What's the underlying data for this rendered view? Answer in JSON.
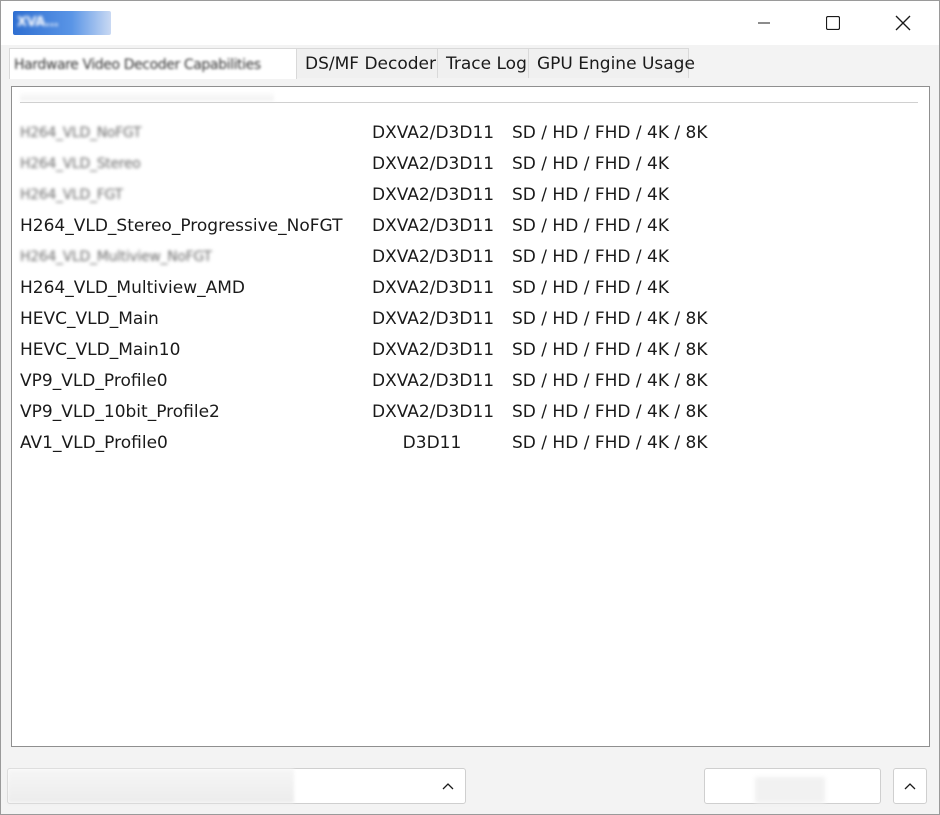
{
  "window": {
    "title": "XVA..."
  },
  "titlebar_buttons": {
    "minimize_icon": "minimize-icon",
    "maximize_icon": "maximize-icon",
    "close_icon": "close-icon"
  },
  "tabs": [
    {
      "label": "Hardware Video Decoder Capabilities",
      "active": true
    },
    {
      "label": "DS/MF Decoder",
      "active": false
    },
    {
      "label": "Trace Log",
      "active": false
    },
    {
      "label": "GPU Engine Usage",
      "active": false
    }
  ],
  "decoder_list": {
    "rows": [
      {
        "name": "H264_VLD_NoFGT",
        "api": "DXVA2/D3D11",
        "resolutions": "SD / HD / FHD / 4K / 8K",
        "name_blurred": true
      },
      {
        "name": "H264_VLD_Stereo",
        "api": "DXVA2/D3D11",
        "resolutions": "SD / HD / FHD / 4K",
        "name_blurred": true
      },
      {
        "name": "H264_VLD_FGT",
        "api": "DXVA2/D3D11",
        "resolutions": "SD / HD / FHD / 4K",
        "name_blurred": true
      },
      {
        "name": "H264_VLD_Stereo_Progressive_NoFGT",
        "api": "DXVA2/D3D11",
        "resolutions": "SD / HD / FHD / 4K",
        "name_blurred": false
      },
      {
        "name": "H264_VLD_Multiview_NoFGT",
        "api": "DXVA2/D3D11",
        "resolutions": "SD / HD / FHD / 4K",
        "name_blurred": true
      },
      {
        "name": "H264_VLD_Multiview_AMD",
        "api": "DXVA2/D3D11",
        "resolutions": "SD / HD / FHD / 4K",
        "name_blurred": false
      },
      {
        "name": "HEVC_VLD_Main",
        "api": "DXVA2/D3D11",
        "resolutions": "SD / HD / FHD / 4K / 8K",
        "name_blurred": false
      },
      {
        "name": "HEVC_VLD_Main10",
        "api": "DXVA2/D3D11",
        "resolutions": "SD / HD / FHD / 4K / 8K",
        "name_blurred": false
      },
      {
        "name": "VP9_VLD_Profile0",
        "api": "DXVA2/D3D11",
        "resolutions": "SD / HD / FHD / 4K / 8K",
        "name_blurred": false
      },
      {
        "name": "VP9_VLD_10bit_Profile2",
        "api": "DXVA2/D3D11",
        "resolutions": "SD / HD / FHD / 4K / 8K",
        "name_blurred": false
      },
      {
        "name": "AV1_VLD_Profile0",
        "api": "D3D11",
        "resolutions": "SD / HD / FHD / 4K / 8K",
        "name_blurred": false
      }
    ]
  },
  "bottombar": {
    "combo_value": "",
    "combo_icon": "chevron-up-icon",
    "right_field_value": "",
    "up_button_icon": "chevron-up-icon"
  },
  "colors": {
    "window_bg": "#f3f3f3",
    "panel_bg": "#ffffff",
    "accent": "#2f6fd1"
  }
}
